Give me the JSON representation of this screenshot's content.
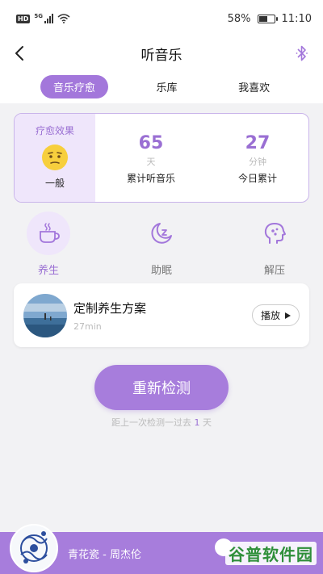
{
  "status_bar": {
    "hd": "HD",
    "network": "5G",
    "battery_percent": "58%",
    "battery_level": 0.58,
    "time": "11:10"
  },
  "nav": {
    "title": "听音乐"
  },
  "tabs": [
    {
      "label": "音乐疗愈",
      "active": true
    },
    {
      "label": "乐库",
      "active": false
    },
    {
      "label": "我喜欢",
      "active": false
    }
  ],
  "stats": {
    "effect_label": "疗愈效果",
    "effect_value": "一般",
    "days": {
      "value": "65",
      "unit": "天",
      "label": "累计听音乐"
    },
    "minutes": {
      "value": "27",
      "unit": "分钟",
      "label": "今日累计"
    }
  },
  "features": [
    {
      "label": "养生",
      "icon": "teacup-icon",
      "active": true
    },
    {
      "label": "助眠",
      "icon": "moon-sleep-icon",
      "active": false
    },
    {
      "label": "解压",
      "icon": "head-relax-icon",
      "active": false
    }
  ],
  "plan": {
    "title": "定制养生方案",
    "duration": "27min",
    "play_label": "播放"
  },
  "retest": {
    "label": "重新检测",
    "hint_prefix": "距上一次检测一过去",
    "hint_num": "1",
    "hint_suffix": "天"
  },
  "player": {
    "now_playing": "青花瓷 - 周杰伦"
  },
  "watermark": "谷普软件园",
  "colors": {
    "accent": "#a377db",
    "accent_light": "#efe6fb",
    "background": "#f2f2f4"
  }
}
